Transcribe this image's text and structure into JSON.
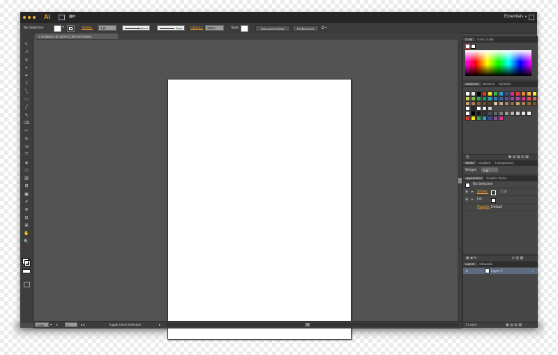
{
  "app": {
    "logo": "Ai",
    "workspace": "Essentials",
    "workspace_arrow": "▼",
    "arrange_icon": "▦▾"
  },
  "control_bar": {
    "selection": "No Selection",
    "stroke_label": "Stroke:",
    "stroke_weight": "1 pt",
    "profile_label": "Uniform",
    "brush_label": "Basic",
    "opacity_label": "Opacity:",
    "opacity_value": "100%",
    "style_label": "Style:",
    "document_setup": "Document Setup",
    "preferences": "Preferences",
    "fill_color": "#ffffff"
  },
  "document": {
    "tab_title": "Untitled-1 @ 100% (CMYK/Preview)",
    "close": "×"
  },
  "status_bar": {
    "zoom": "100%",
    "artboard_nav": "1",
    "status_text": "Toggle Direct Selection"
  },
  "panels": {
    "color": {
      "tabs": [
        "Color",
        "Color Guide"
      ]
    },
    "swatches": {
      "tabs": [
        "Swatches",
        "Brushes",
        "Symbols"
      ],
      "rows": [
        [
          "#ffffff",
          "#e5e5e5",
          "#000000",
          "#e6302a",
          "#f6eb16",
          "#3db249",
          "#2c9dd8",
          "#3450a3",
          "#eb2b7b",
          "#ee3e45",
          "#f08133",
          "#f8af3f",
          "#f5e83f"
        ],
        [
          "#c8d855",
          "#7bc043",
          "#33a852",
          "#1c9c7a",
          "#21a9c1",
          "#2d7ec3",
          "#3a5ea9",
          "#5b4b9f",
          "#8a4d9f",
          "#b0479b",
          "#e2318b",
          "#ea4c5f",
          "#c86a4e"
        ],
        [
          "#cf9c74",
          "#a77c57",
          "#8a6039",
          "#6e4b2e",
          "#5c3a24",
          "#d6c4a8",
          "#bca687",
          "#9d8766",
          "#806a4b",
          "#c9a370",
          "#aa8452",
          "#8f6b3c",
          "#715431"
        ],
        [
          "#ffffff",
          "#2a2a2a",
          "#ffffff",
          "#e8e8e8",
          "#d4d4d4"
        ],
        [
          "#ffffff",
          "#000000",
          "#1a1a1a",
          "#333333",
          "#4d4d4d",
          "#666666",
          "#808080",
          "#999999",
          "#b3b3b3",
          "#cccccc",
          "#e6e6e6",
          "#f2f2f2"
        ],
        [
          "#e63329",
          "#f6eb16",
          "#36a94f",
          "#2c9dd8",
          "#3450a3",
          "#8a4d9f",
          "#e2318b"
        ]
      ]
    },
    "stroke": {
      "tabs": [
        "Stroke",
        "Gradient",
        "Transparency"
      ],
      "weight_label": "Weight:",
      "weight_value": "1 pt"
    },
    "appearance": {
      "tabs": [
        "Appearance",
        "Graphic Styles"
      ],
      "title": "No Selection",
      "stroke_label": "Stroke:",
      "stroke_value": "1 pt",
      "fill_label": "Fill:",
      "opacity_label": "Opacity:",
      "opacity_value": "Default"
    },
    "layers": {
      "tabs": [
        "Layers",
        "Artboards"
      ],
      "layer_name": "Layer 1",
      "count": "1 Layer"
    }
  },
  "toolbar": {
    "tools": [
      "↖",
      "↗",
      "⚲",
      "⌖",
      "✒",
      "T",
      "╲",
      "▭",
      "╱",
      "✎",
      "⌫",
      "✂",
      "↻",
      "⇲",
      "⤧",
      "◈",
      "⬡",
      "▥",
      "⊞",
      "▣",
      "✐",
      "⊕",
      "⊟",
      "⌘",
      "✋",
      "🔍"
    ]
  }
}
